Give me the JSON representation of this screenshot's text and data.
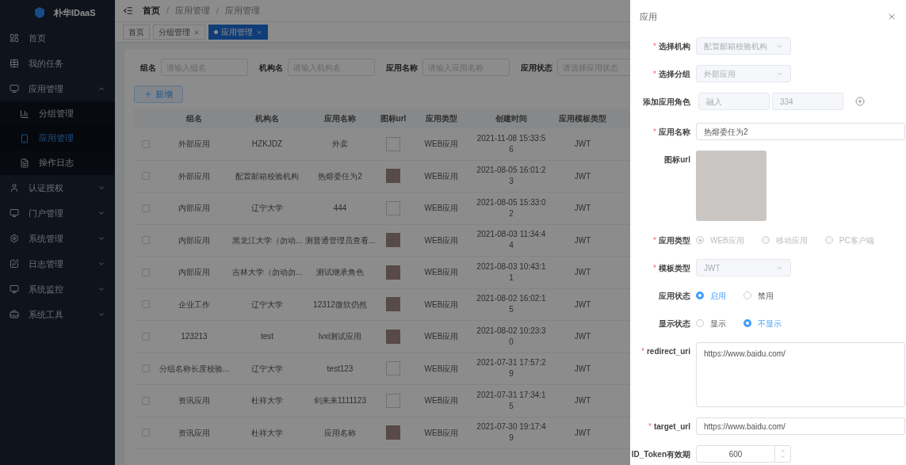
{
  "sidebar": {
    "logo": "朴华IDaaS",
    "items": [
      {
        "label": "首页",
        "expandable": false,
        "selected": false
      },
      {
        "label": "我的任务",
        "expandable": false,
        "selected": false
      },
      {
        "label": "应用管理",
        "expandable": true,
        "expanded": true,
        "selected": false,
        "children": [
          {
            "label": "分组管理",
            "selected": false
          },
          {
            "label": "应用管理",
            "selected": true
          },
          {
            "label": "操作日志",
            "selected": false
          }
        ]
      },
      {
        "label": "认证授权",
        "expandable": true,
        "expanded": false,
        "selected": false
      },
      {
        "label": "门户管理",
        "expandable": true,
        "expanded": false,
        "selected": false
      },
      {
        "label": "系统管理",
        "expandable": true,
        "expanded": false,
        "selected": false
      },
      {
        "label": "日志管理",
        "expandable": true,
        "expanded": false,
        "selected": false
      },
      {
        "label": "系统监控",
        "expandable": true,
        "expanded": false,
        "selected": false
      },
      {
        "label": "系统工具",
        "expandable": true,
        "expanded": false,
        "selected": false
      }
    ]
  },
  "breadcrumb": {
    "separator": "/",
    "items": [
      "首页",
      "应用管理",
      "应用管理"
    ]
  },
  "tags": [
    {
      "label": "首页",
      "closable": false,
      "selected": false
    },
    {
      "label": "分组管理",
      "closable": true,
      "selected": false
    },
    {
      "label": "应用管理",
      "closable": true,
      "selected": true
    }
  ],
  "filters": [
    {
      "label": "组名",
      "placeholder": "请输入组名"
    },
    {
      "label": "机构名",
      "placeholder": "请输入机构名"
    },
    {
      "label": "应用名称",
      "placeholder": "请输入应用名称"
    },
    {
      "label": "应用状态",
      "placeholder": "请选择应用状态"
    }
  ],
  "add_button": "新增",
  "table": {
    "columns": [
      "组名",
      "机构名",
      "应用名称",
      "图标url",
      "应用类型",
      "创建时间",
      "应用模板类型"
    ],
    "rows": [
      {
        "checked": false,
        "cells": [
          "外部应用",
          "HZKJDZ",
          "外卖"
        ],
        "kind": "empty",
        "type": "WEB应用",
        "created": "2021-11-08 15:33:56",
        "template": "JWT"
      },
      {
        "checked": false,
        "cells": [
          "外部应用",
          "配置邮箱校验机构",
          "热熔委任为2"
        ],
        "kind": "photo",
        "type": "WEB应用",
        "created": "2021-08-05 16:01:23",
        "template": "JWT"
      },
      {
        "checked": false,
        "cells": [
          "内部应用",
          "辽宁大学",
          "444"
        ],
        "kind": "empty",
        "type": "WEB应用",
        "created": "2021-08-05 15:33:02",
        "template": "JWT"
      },
      {
        "checked": false,
        "cells": [
          "内部应用",
          "黑龙江大学（勿动...",
          "测普通管理员查看..."
        ],
        "kind": "photo",
        "type": "WEB应用",
        "created": "2021-08-03 11:34:44",
        "template": "JWT"
      },
      {
        "checked": false,
        "cells": [
          "内部应用",
          "吉林大学（勿动勿...",
          "测试继承角色"
        ],
        "kind": "photo",
        "type": "WEB应用",
        "created": "2021-08-03 10:43:11",
        "template": "JWT"
      },
      {
        "checked": false,
        "cells": [
          "企业工作",
          "辽宁大学",
          "12312微软仍然"
        ],
        "kind": "photo",
        "type": "WEB应用",
        "created": "2021-08-02 16:02:15",
        "template": "JWT"
      },
      {
        "checked": false,
        "cells": [
          "123213",
          "test",
          "lvxi测试应用"
        ],
        "kind": "photo",
        "type": "WEB应用",
        "created": "2021-08-02 10:23:30",
        "template": "JWT"
      },
      {
        "checked": false,
        "cells": [
          "分组名称长度校验...",
          "辽宁大学",
          "test123"
        ],
        "kind": "empty",
        "type": "WEB应用",
        "created": "2021-07-31 17:57:29",
        "template": "JWT"
      },
      {
        "checked": false,
        "cells": [
          "资讯应用",
          "杜祥大学",
          "剑来来1111123"
        ],
        "kind": "empty",
        "type": "WEB应用",
        "created": "2021-07-31 17:34:15",
        "template": "JWT"
      },
      {
        "checked": false,
        "cells": [
          "资讯应用",
          "杜祥大学",
          "应用名称"
        ],
        "kind": "photo",
        "type": "WEB应用",
        "created": "2021-07-30 19:17:49",
        "template": "JWT"
      }
    ]
  },
  "drawer": {
    "title": "应用",
    "required_mark": "*",
    "fields": [
      {
        "kind": "select",
        "label": "选择机构",
        "required": true,
        "value": "配置邮箱校验机构",
        "disabled": true
      },
      {
        "kind": "select",
        "label": "选择分组",
        "required": true,
        "value": "外部应用",
        "disabled": true
      },
      {
        "kind": "pair",
        "label": "添加应用角色",
        "required": false,
        "values": [
          "融入",
          "334"
        ],
        "disabled": true
      },
      {
        "kind": "input",
        "label": "应用名称",
        "required": true,
        "value": "热熔委任为2",
        "disabled": false
      },
      {
        "kind": "image",
        "label": "图标url",
        "required": false
      },
      {
        "kind": "radio",
        "label": "应用类型",
        "required": true,
        "disabled": true,
        "options": [
          {
            "label": "WEB应用",
            "selected": true
          },
          {
            "label": "移动应用",
            "selected": false
          },
          {
            "label": "PC客户端",
            "selected": false
          }
        ]
      },
      {
        "kind": "select",
        "label": "模板类型",
        "required": true,
        "value": "JWT",
        "disabled": true
      },
      {
        "kind": "radio",
        "label": "应用状态",
        "required": false,
        "disabled": false,
        "options": [
          {
            "label": "启用",
            "selected": true
          },
          {
            "label": "禁用",
            "selected": false
          }
        ]
      },
      {
        "kind": "radio",
        "label": "显示状态",
        "required": false,
        "disabled": false,
        "options": [
          {
            "label": "显示",
            "selected": false
          },
          {
            "label": "不显示",
            "selected": true
          }
        ]
      },
      {
        "kind": "textarea",
        "label": "redirect_uri",
        "required": true,
        "value": "https://www.baidu.com/",
        "disabled": false
      },
      {
        "kind": "input",
        "label": "target_url",
        "required": true,
        "value": "https://www.baidu.com/",
        "disabled": false
      },
      {
        "kind": "number",
        "label": "ID_Token有效期",
        "required": false,
        "value": "600",
        "disabled": false
      }
    ]
  }
}
